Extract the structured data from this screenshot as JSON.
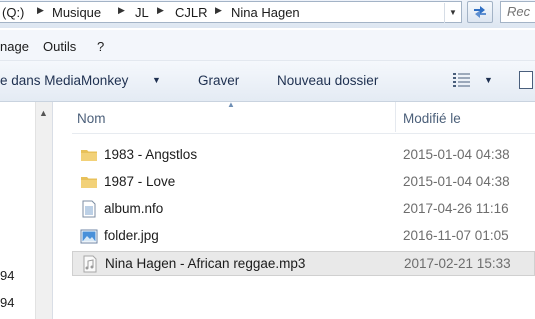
{
  "address": {
    "crumbs": [
      "(Q:)",
      "Musique",
      "JL",
      "CJLR",
      "Nina Hagen"
    ],
    "search_placeholder": "Rec"
  },
  "menu": [
    "nage",
    "Outils",
    "?"
  ],
  "commands": {
    "mediamonkey": "e dans MediaMonkey",
    "burn": "Graver",
    "new_folder": "Nouveau dossier"
  },
  "nav_fragments": [
    "94",
    "94"
  ],
  "columns": {
    "name": "Nom",
    "modified": "Modifié le"
  },
  "files": [
    {
      "name": "1983 - Angstlos",
      "date": "2015-01-04 04:38",
      "icon": "folder-icon"
    },
    {
      "name": "1987 - Love",
      "date": "2015-01-04 04:38",
      "icon": "folder-icon"
    },
    {
      "name": "album.nfo",
      "date": "2017-04-26 11:16",
      "icon": "nfo-file-icon"
    },
    {
      "name": "folder.jpg",
      "date": "2016-11-07 01:05",
      "icon": "image-file-icon"
    },
    {
      "name": "Nina Hagen - African reggae.mp3",
      "date": "2017-02-21 15:33",
      "icon": "audio-file-icon",
      "selected": true
    }
  ],
  "colors": {
    "header_text": "#4c607a",
    "selection": "#e9e9e9",
    "folder": "#e8c15a"
  }
}
